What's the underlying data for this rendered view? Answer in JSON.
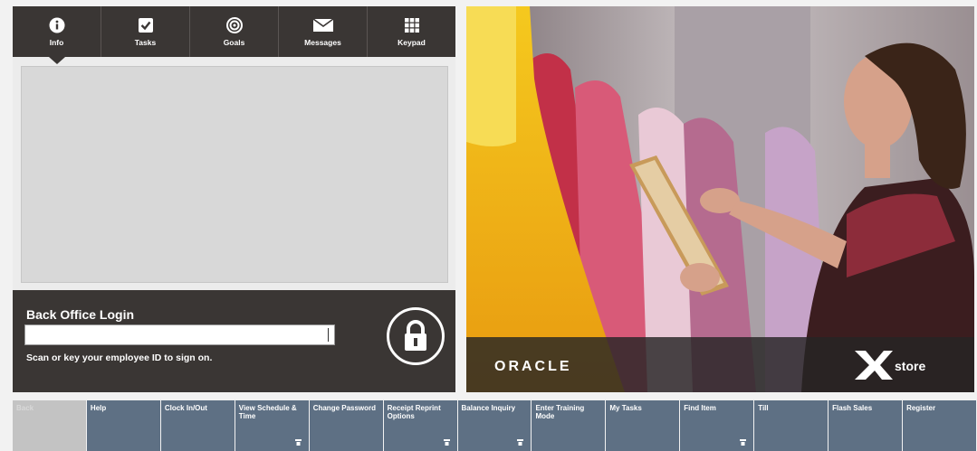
{
  "tabs": [
    {
      "label": "Info",
      "icon": "info-icon"
    },
    {
      "label": "Tasks",
      "icon": "checkbox-icon"
    },
    {
      "label": "Goals",
      "icon": "target-icon"
    },
    {
      "label": "Messages",
      "icon": "envelope-icon"
    },
    {
      "label": "Keypad",
      "icon": "keypad-icon"
    }
  ],
  "login": {
    "title": "Back Office Login",
    "input_value": "",
    "hint": "Scan or key your employee ID to sign on.",
    "lock_icon": "lock-icon"
  },
  "hero": {
    "brand_left": "ORACLE",
    "brand_right": "store",
    "brand_x_icon": "xstore-x-logo"
  },
  "bottom_buttons": [
    {
      "label": "Back",
      "disabled": true
    },
    {
      "label": "Help"
    },
    {
      "label": "Clock In/Out"
    },
    {
      "label": "View Schedule & Time",
      "has_icon": true
    },
    {
      "label": "Change Password"
    },
    {
      "label": "Receipt Reprint Options",
      "has_icon": true
    },
    {
      "label": "Balance Inquiry",
      "has_icon": true
    },
    {
      "label": "Enter Training Mode"
    },
    {
      "label": "My Tasks"
    },
    {
      "label": "Find Item",
      "has_icon": true
    },
    {
      "label": "Till"
    },
    {
      "label": "Flash Sales"
    },
    {
      "label": "Register"
    }
  ],
  "colors": {
    "panel_dark": "#3a3634",
    "button_blue": "#5e7084",
    "button_disabled": "#c3c3c3"
  }
}
